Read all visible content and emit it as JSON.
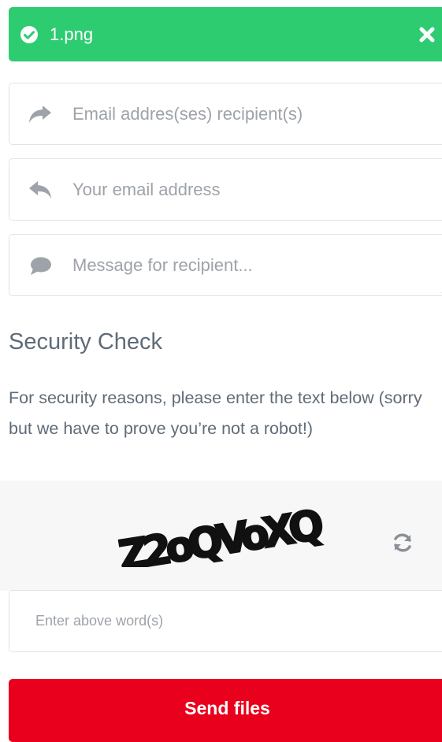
{
  "upload": {
    "file_name": "1.png",
    "bar_color": "#2ecc71"
  },
  "form": {
    "recipients_placeholder": "Email addres(ses) recipient(s)",
    "sender_placeholder": "Your email address",
    "message_placeholder": "Message for recipient...",
    "recipients_value": "",
    "sender_value": "",
    "message_value": ""
  },
  "security": {
    "title": "Security Check",
    "description": "For security reasons, please enter the text below (sorry but we have to prove you’re not a robot!)",
    "captcha_text": "Z2oQVoXQ",
    "input_placeholder": "Enter above word(s)",
    "input_value": ""
  },
  "actions": {
    "send_label": "Send files",
    "send_color": "#e8001c"
  },
  "icons": {
    "check": "check-circle-icon",
    "close": "close-icon",
    "recipients": "share-forward-icon",
    "sender": "reply-icon",
    "message": "comment-icon",
    "refresh": "refresh-icon"
  }
}
